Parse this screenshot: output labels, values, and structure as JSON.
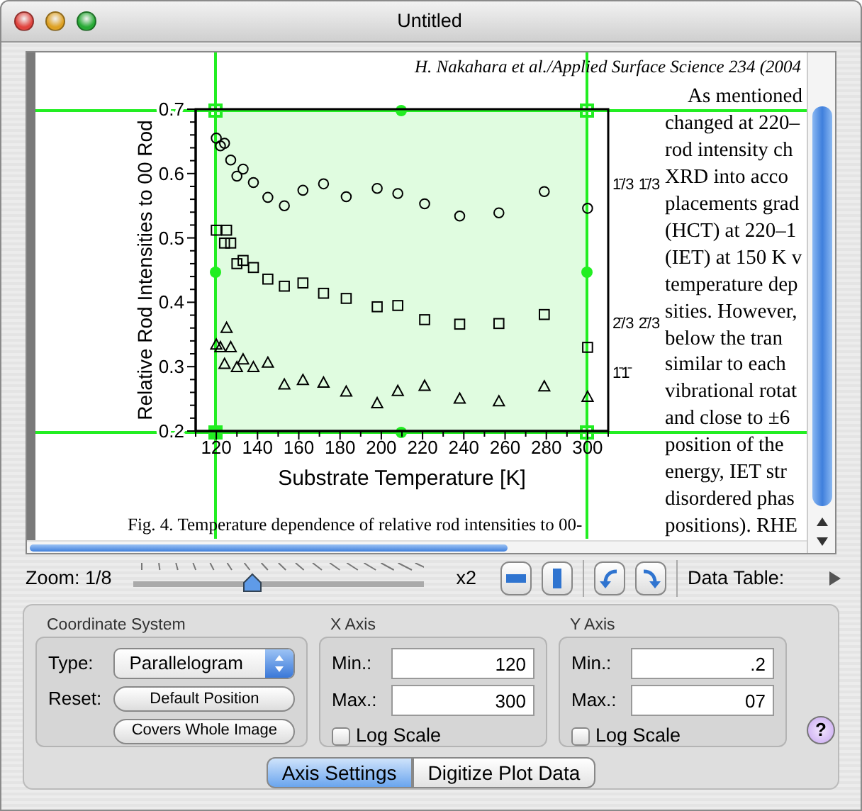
{
  "window": {
    "title": "Untitled"
  },
  "document": {
    "header": "H. Nakahara et al./Applied Surface Science 234 (2004",
    "chart_data": {
      "type": "scatter",
      "xlabel": "Substrate Temperature [K]",
      "ylabel": "Relative Rod Intensities to 00 Rod",
      "xlim": [
        110,
        310
      ],
      "ylim": [
        0.2,
        0.7
      ],
      "xticks": [
        120,
        140,
        160,
        180,
        200,
        220,
        240,
        260,
        280,
        300
      ],
      "yticks": [
        0.2,
        0.3,
        0.4,
        0.5,
        0.6,
        0.7
      ],
      "x": [
        120,
        122,
        124,
        125,
        127,
        130,
        133,
        138,
        145,
        153,
        162,
        172,
        183,
        198,
        208,
        221,
        238,
        257,
        279,
        300
      ],
      "series": [
        {
          "name": "1̄/3 1̄/3",
          "values": [
            0.655,
            0.643,
            0.647,
            null,
            0.621,
            0.596,
            0.607,
            0.586,
            0.563,
            0.55,
            0.574,
            0.584,
            0.564,
            0.577,
            0.569,
            0.553,
            0.534,
            0.539,
            0.572,
            0.546
          ]
        },
        {
          "name": "2̄/3 2̄/3",
          "values": [
            0.512,
            null,
            0.492,
            0.512,
            0.492,
            0.46,
            0.465,
            0.454,
            0.436,
            0.425,
            0.43,
            0.414,
            0.406,
            0.393,
            0.395,
            0.373,
            0.366,
            0.367,
            0.381,
            0.33
          ]
        },
        {
          "name": "1̄1̄",
          "values": [
            0.334,
            0.33,
            0.304,
            0.36,
            0.33,
            0.299,
            0.311,
            0.299,
            0.306,
            0.272,
            0.279,
            0.275,
            0.261,
            0.243,
            0.262,
            0.27,
            0.25,
            0.246,
            0.269,
            0.253
          ]
        }
      ]
    },
    "caption": "Fig. 4. Temperature dependence of relative rod intensities to 00-",
    "body_lines": [
      {
        "text": "As mentioned",
        "indent": true
      },
      {
        "text": "changed at 220–",
        "indent": false
      },
      {
        "text": "rod intensity ch",
        "indent": false
      },
      {
        "text": "XRD into acco",
        "indent": false
      },
      {
        "text": "placements grad",
        "indent": false
      },
      {
        "text": "(HCT) at 220–1",
        "indent": false
      },
      {
        "text": "(IET) at 150 K v",
        "indent": false
      },
      {
        "text": "temperature dep",
        "indent": false
      },
      {
        "text": "sities. However,",
        "indent": false
      },
      {
        "text": "below the tran",
        "indent": false
      },
      {
        "text": "similar to each",
        "indent": false
      },
      {
        "text": "vibrational rotat",
        "indent": false
      },
      {
        "text": "and close to ±6",
        "indent": false
      },
      {
        "text": "position of the",
        "indent": false
      },
      {
        "text": "energy, IET str",
        "indent": false
      },
      {
        "text": "disordered phas",
        "indent": false
      },
      {
        "text": "positions). RHE",
        "indent": false
      }
    ]
  },
  "toolbar": {
    "zoom_label": "Zoom: 1/8",
    "zoom_slider": {
      "level": 0.41
    },
    "zoom_max_label": "x2",
    "data_table_label": "Data Table:",
    "data_table_expanded": false
  },
  "coordinate_system": {
    "title": "Coordinate System",
    "type_label": "Type:",
    "type_value": "Parallelogram",
    "reset_label": "Reset:",
    "buttons": [
      "Default Position",
      "Covers Whole Image"
    ]
  },
  "axes": [
    {
      "title": "X Axis",
      "min_label": "Min.:",
      "min": "120",
      "max_label": "Max.:",
      "max": "300",
      "log_scale": {
        "label": "Log Scale",
        "checked": false
      }
    },
    {
      "title": "Y Axis",
      "min_label": "Min.:",
      "min": ".2",
      "max_label": "Max.:",
      "max": "07",
      "log_scale": {
        "label": "Log Scale",
        "checked": false
      }
    }
  ],
  "help_button": "?",
  "tabs": [
    {
      "label": "Axis Settings",
      "selected": true
    },
    {
      "label": "Digitize Plot Data",
      "selected": false
    }
  ]
}
